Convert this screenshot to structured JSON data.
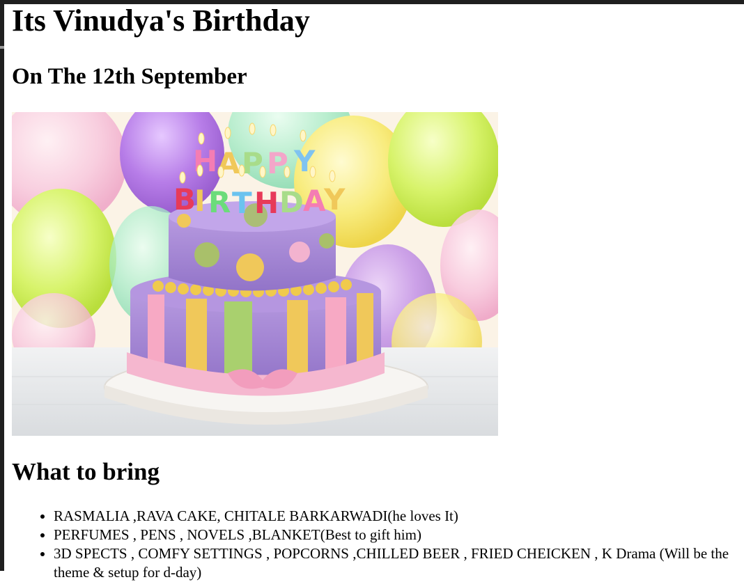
{
  "page": {
    "title": "Its Vinudya's Birthday",
    "date_heading": "On The 12th September",
    "bring_heading": "What to bring"
  },
  "image": {
    "subject": "birthday cake with candles and balloons",
    "cake_letters": "HAPPY BIRTHDAY"
  },
  "items": [
    "RASMALIA ,RAVA CAKE, CHITALE BARKARWADI(he loves It)",
    "PERFUMES , PENS , NOVELS ,BLANKET(Best to gift him)",
    "3D SPECTS , COMFY SETTINGS , POPCORNS ,CHILLED BEER , FRIED CHEICKEN , K Drama (Will be the theme & setup for d-day)"
  ]
}
